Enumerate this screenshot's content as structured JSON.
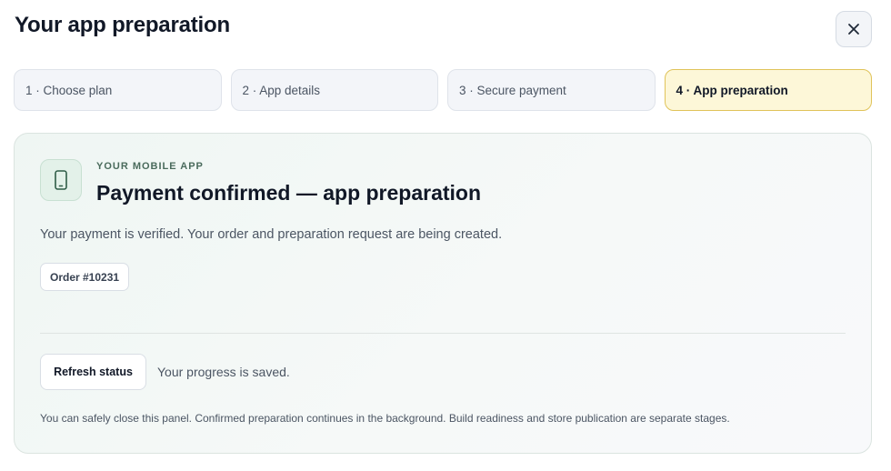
{
  "header": {
    "title": "Your app preparation",
    "close_icon": "close-icon"
  },
  "steps": [
    {
      "label": "1 · Choose plan",
      "active": false
    },
    {
      "label": "2 · App details",
      "active": false
    },
    {
      "label": "3 · Secure payment",
      "active": false
    },
    {
      "label": "4 · App preparation",
      "active": true
    }
  ],
  "panel": {
    "icon": "mobile-phone-icon",
    "eyebrow": "YOUR MOBILE APP",
    "title": "Payment confirmed — app preparation",
    "description": "Your payment is verified. Your order and preparation request are being created.",
    "order_label": "Order #10231",
    "refresh_label": "Refresh status",
    "progress_note": "Your progress is saved.",
    "footnote": "You can safely close this panel. Confirmed preparation continues in the background. Build readiness and store publication are separate stages."
  },
  "colors": {
    "active_step_bg": "#fdf7d8",
    "active_step_border": "#e0c35a",
    "accent_green": "#2f7a52"
  }
}
